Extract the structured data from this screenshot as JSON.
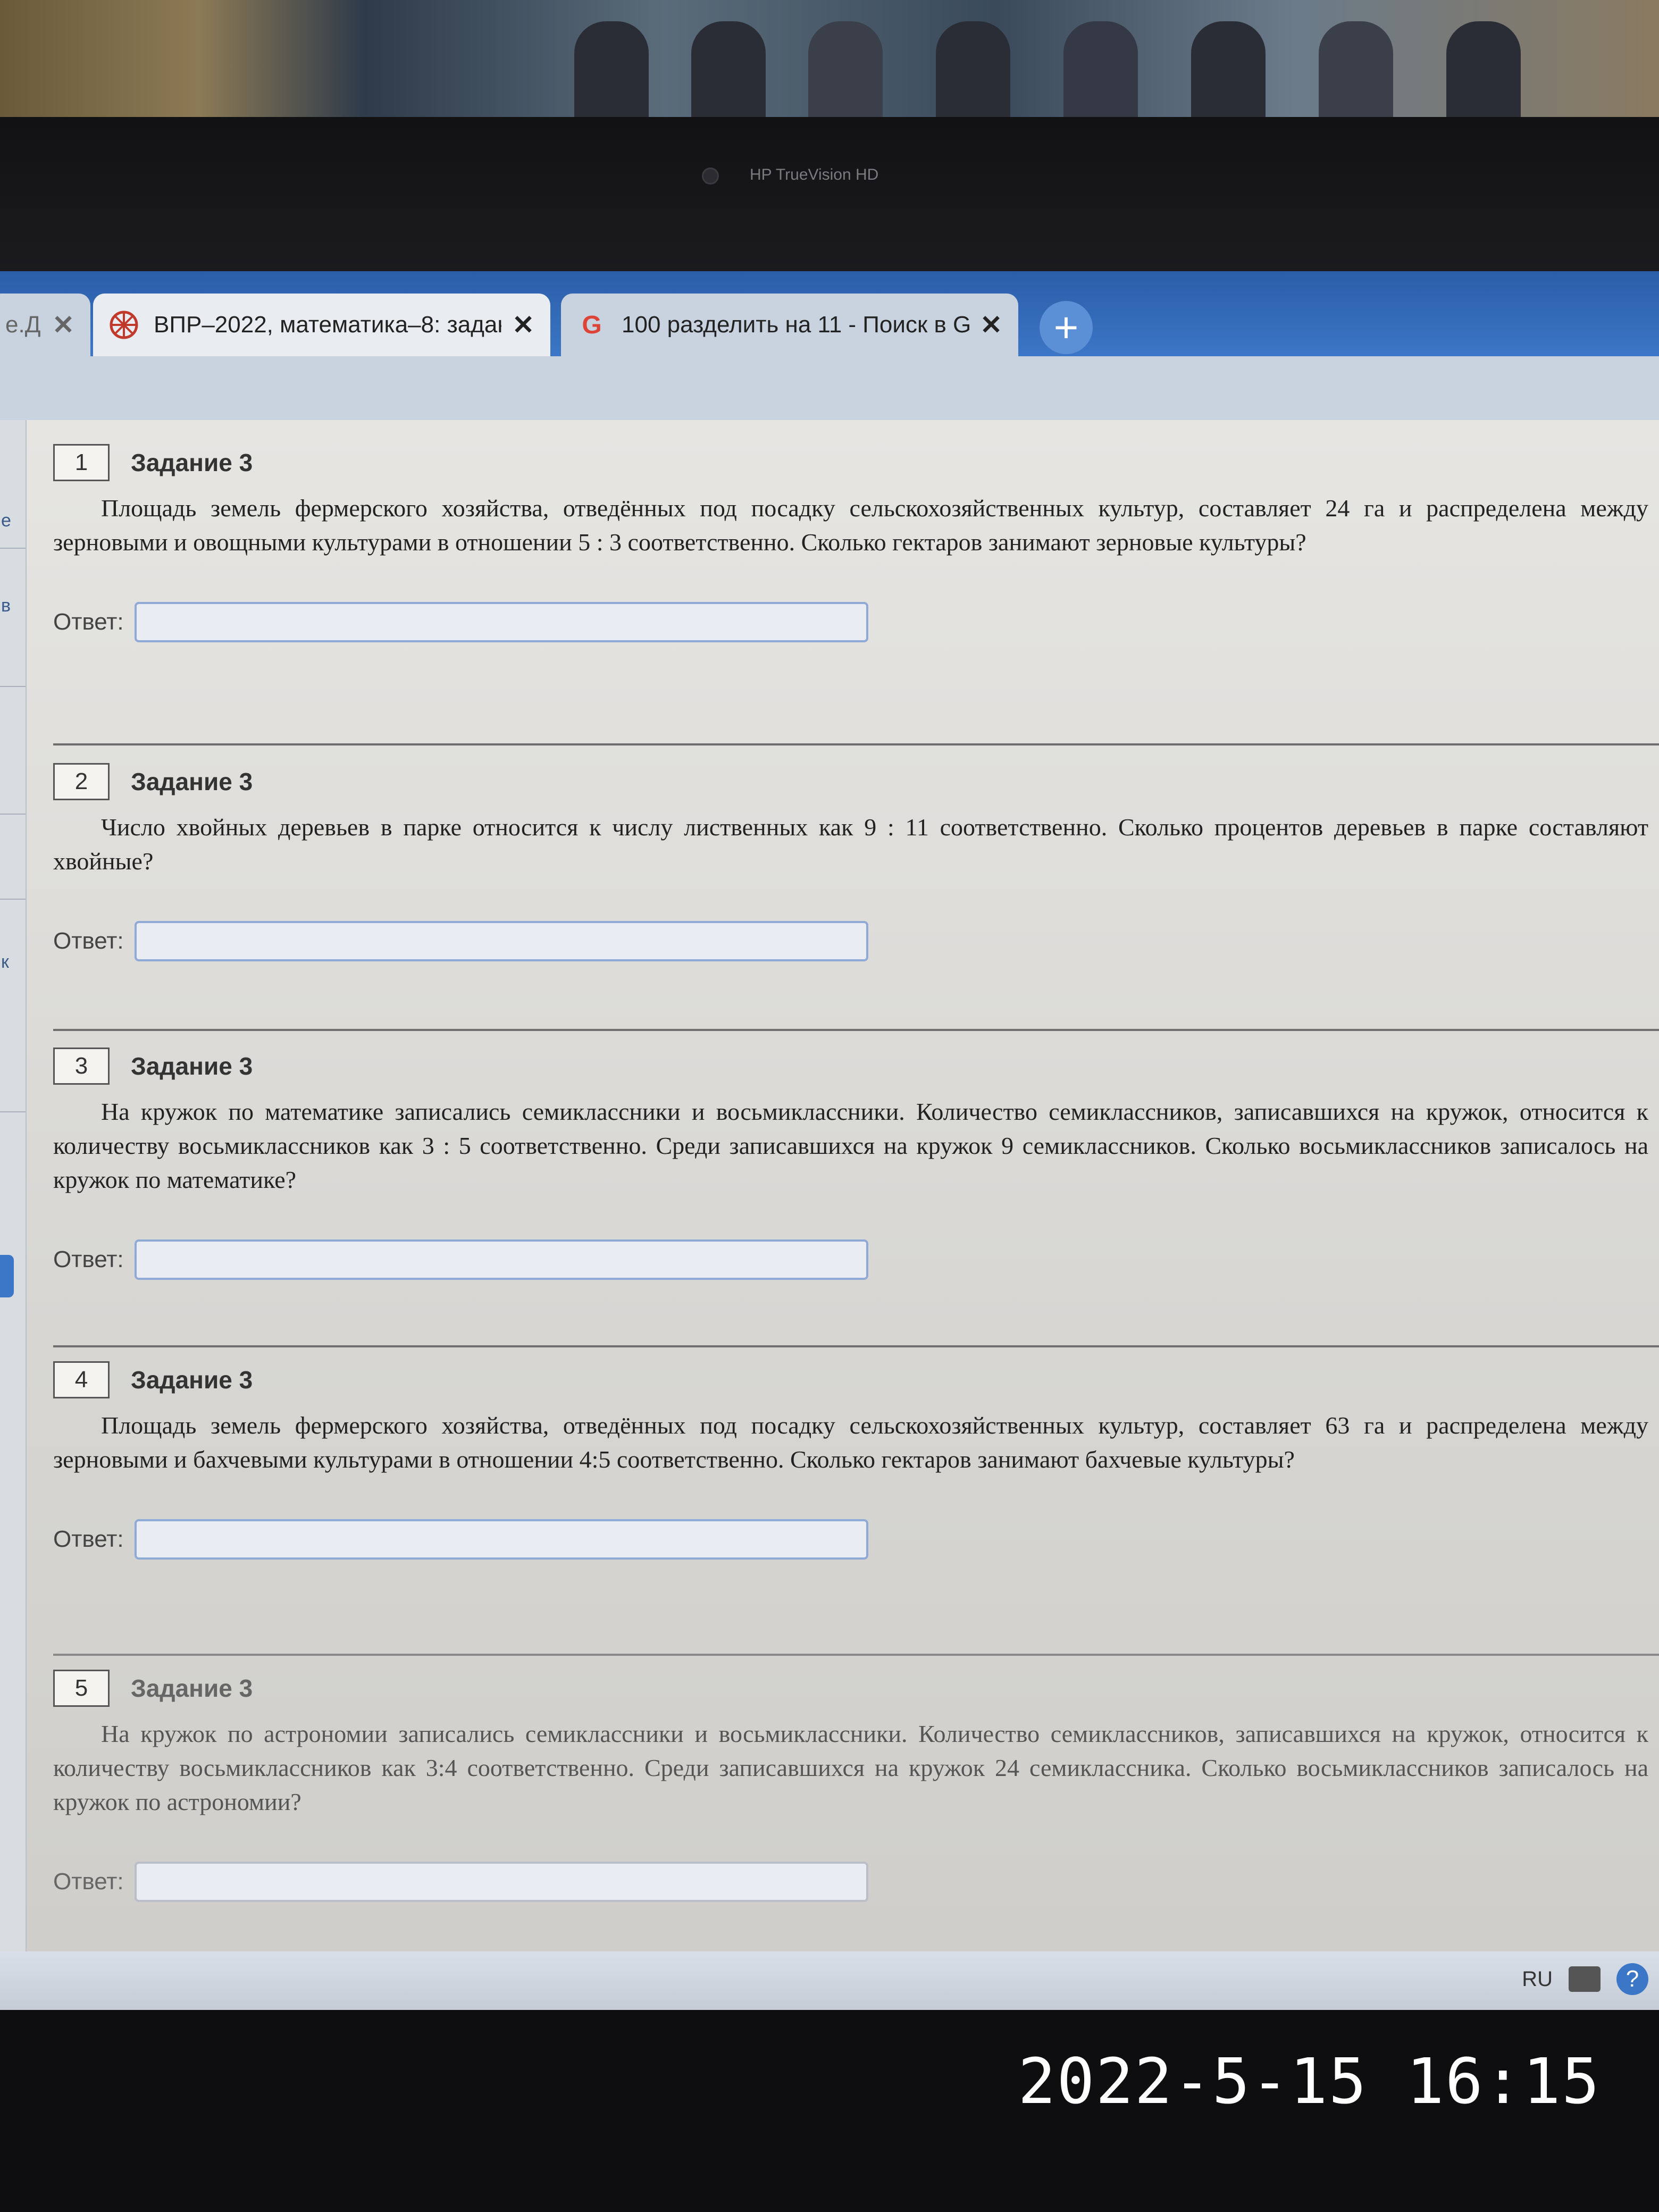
{
  "camera_label": "HP TrueVision HD",
  "tabs": [
    {
      "title": "е.Д",
      "icon": "",
      "close": "✕"
    },
    {
      "title": "ВПР–2022, математика–8: задан",
      "icon": "reshu-logo-icon",
      "close": "✕"
    },
    {
      "title": "100 разделить на 11 - Поиск в G",
      "icon": "G",
      "close": "✕"
    }
  ],
  "new_tab": "+",
  "left_strip": [
    "е",
    "в",
    "к"
  ],
  "answer_label": "Ответ:",
  "tasks": [
    {
      "number": "1",
      "title": "Задание 3",
      "text": "Площадь земель фермерского хозяйства, отведённых под посадку сельскохозяйственных культур, составляет 24 га и распределена между зерновыми и овощными культурами в отношении 5 : 3 соответственно. Сколько гектаров занимают зерновые культуры?",
      "answer": ""
    },
    {
      "number": "2",
      "title": "Задание 3",
      "text": "Число хвойных деревьев в парке относится к числу лиственных как 9 : 11 соответственно. Сколько процентов деревьев в парке составляют хвойные?",
      "answer": ""
    },
    {
      "number": "3",
      "title": "Задание 3",
      "text": "На кружок по математике записались семиклассники и восьмиклассники. Количество семиклассников, записавшихся на кружок, относится к количеству восьмиклассников как 3 : 5 соответственно. Среди записавшихся на кружок 9 семиклассников. Сколько восьмиклассников записалось на кружок по математике?",
      "answer": ""
    },
    {
      "number": "4",
      "title": "Задание 3",
      "text": "Площадь земель фермерского хозяйства, отведённых под посадку сельскохозяйственных культур, составляет 63 га и распределена между зерновыми и бахчевыми культурами в отношении 4:5 соответственно. Сколько гектаров занимают бахчевые культуры?",
      "answer": ""
    },
    {
      "number": "5",
      "title": "Задание 3",
      "text": "На кружок по астрономии записались семиклассники и восьмиклассники. Количество семиклассников, записавшихся на кружок, относится к количеству восьмиклассников как 3:4 соответственно. Среди записавшихся на кружок 24 семиклассника. Сколько восьмиклассников записалось на кружок по астрономии?",
      "answer": ""
    }
  ],
  "taskbar": {
    "language": "RU",
    "help": "?"
  },
  "timestamp": "2022-5-15 16:15"
}
